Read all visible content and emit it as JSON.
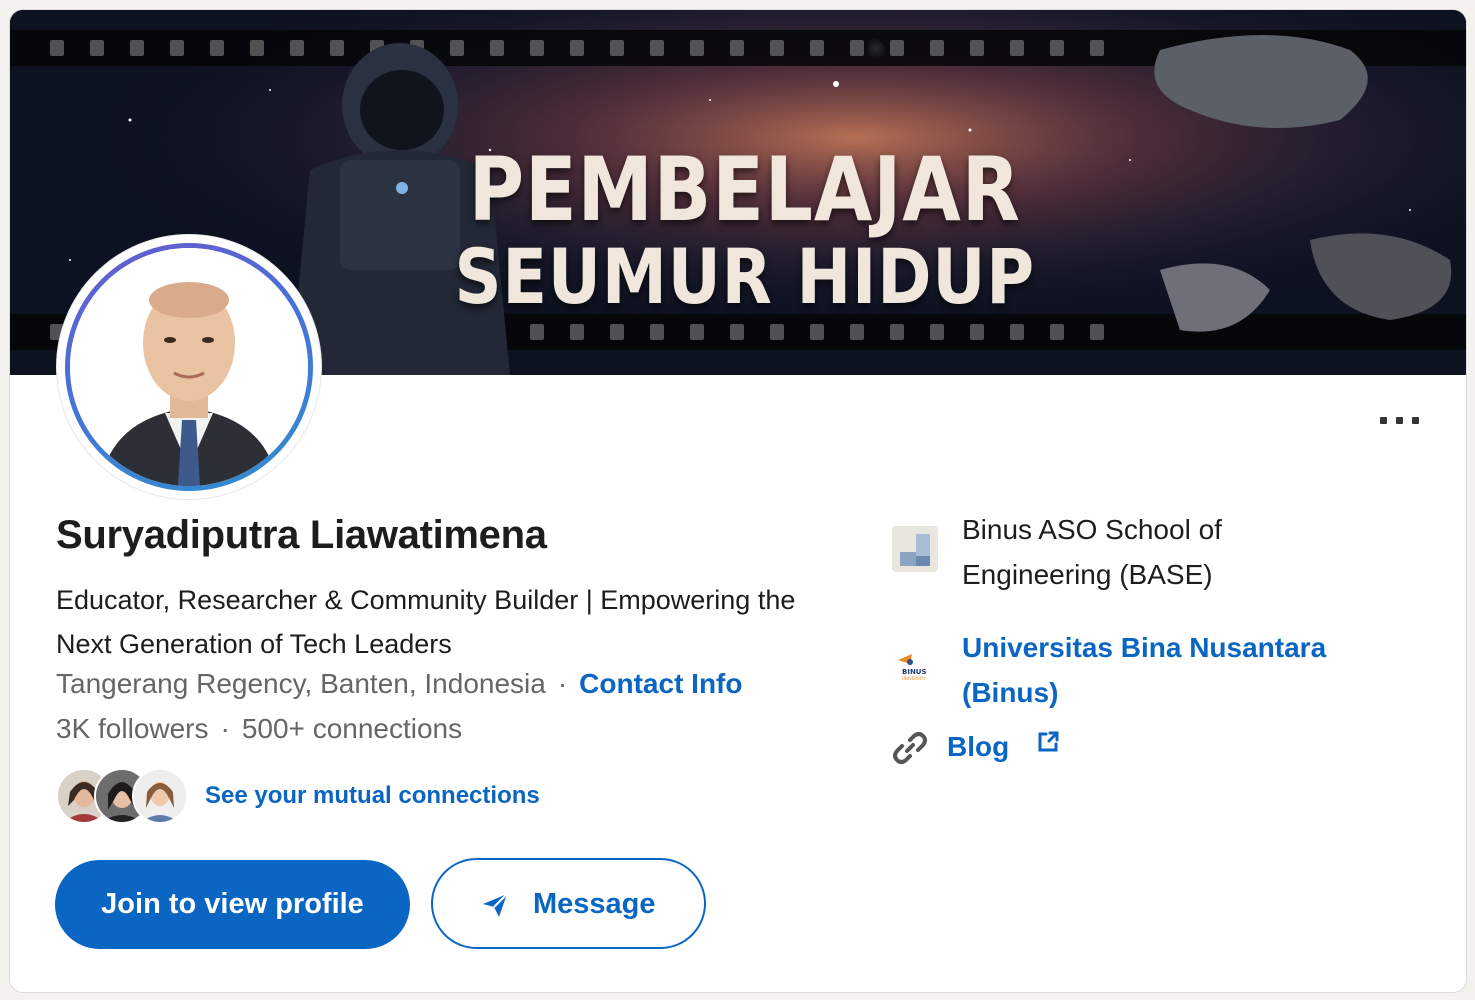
{
  "banner": {
    "line1": "PEMBELAJAR",
    "line2": "SEUMUR HIDUP"
  },
  "profile": {
    "name": "Suryadiputra Liawatimena",
    "headline": "Educator, Researcher & Community Builder | Empowering the Next Generation of Tech Leaders",
    "location": "Tangerang Regency, Banten, Indonesia",
    "separator": "·",
    "contact_info_label": "Contact Info",
    "followers": "3K followers",
    "connections": "500+ connections",
    "mutual_connections_label": "See your mutual connections"
  },
  "actions": {
    "join_label": "Join to view profile",
    "message_label": "Message",
    "more_icon": "more-horizontal-icon"
  },
  "sidebar": {
    "company": "Binus ASO School of Engineering (BASE)",
    "company_line1": "Binus ASO School of",
    "company_line2": "Engineering (BASE)",
    "school_line1": "Universitas Bina Nusantara",
    "school_line2": "(Binus)",
    "blog_label": "Blog",
    "company_icon": "company-logo-icon",
    "school_icon": "binus-university-logo-icon",
    "link_icon": "link-icon",
    "external_icon": "external-link-icon",
    "logo_text": "BINUS",
    "logo_subtext": "UNIVERSITY"
  },
  "colors": {
    "accent": "#0a66c2",
    "text_primary": "#1d1d1d",
    "text_secondary": "#666666"
  }
}
